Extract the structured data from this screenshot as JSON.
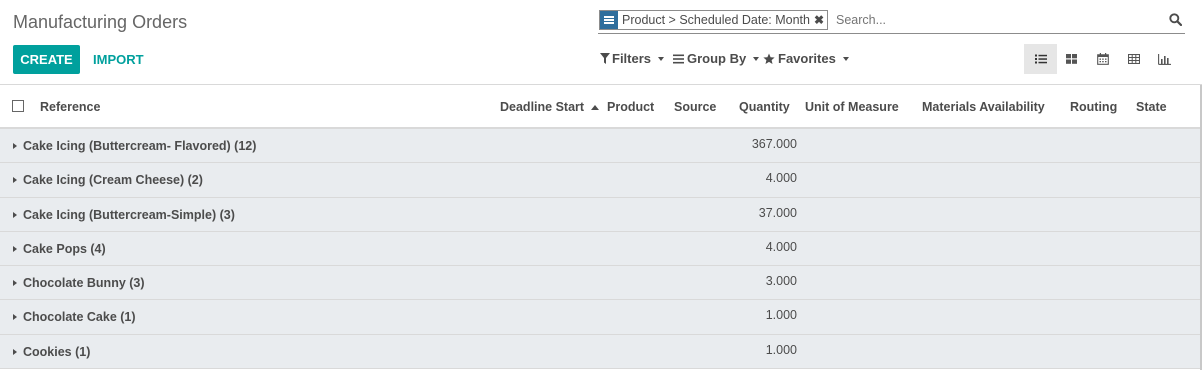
{
  "page": {
    "title": "Manufacturing Orders"
  },
  "buttons": {
    "create": "CREATE",
    "import": "IMPORT"
  },
  "search": {
    "facet_label": "Product > Scheduled Date: Month",
    "facet_remove": "✖",
    "placeholder": "Search..."
  },
  "filters": {
    "filters": "Filters",
    "group_by": "Group By",
    "favorites": "Favorites"
  },
  "views": [
    "list",
    "kanban",
    "calendar",
    "pivot",
    "graph"
  ],
  "columns": {
    "reference": "Reference",
    "deadline_start": "Deadline Start",
    "product": "Product",
    "source": "Source",
    "quantity": "Quantity",
    "uom": "Unit of Measure",
    "materials": "Materials Availability",
    "routing": "Routing",
    "state": "State"
  },
  "groups": [
    {
      "name": "Cake Icing (Buttercream- Flavored) (12)",
      "qty": "367.000"
    },
    {
      "name": "Cake Icing (Cream Cheese) (2)",
      "qty": "4.000"
    },
    {
      "name": "Cake Icing (Buttercream-Simple) (3)",
      "qty": "37.000"
    },
    {
      "name": "Cake Pops (4)",
      "qty": "4.000"
    },
    {
      "name": "Chocolate Bunny (3)",
      "qty": "3.000"
    },
    {
      "name": "Chocolate Cake (1)",
      "qty": "1.000"
    },
    {
      "name": "Cookies (1)",
      "qty": "1.000"
    }
  ]
}
